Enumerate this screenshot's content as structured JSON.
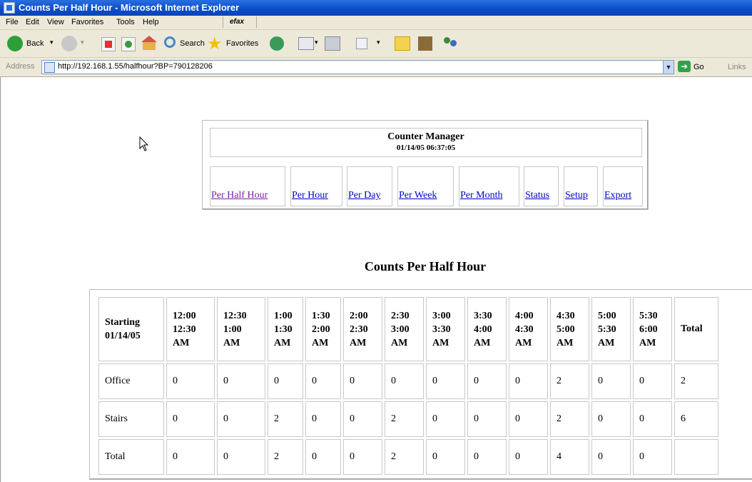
{
  "window": {
    "title": "Counts Per Half Hour - Microsoft Internet Explorer"
  },
  "menu": [
    "File",
    "Edit",
    "View",
    "Favorites",
    "Tools",
    "Help"
  ],
  "efax_label": "efax",
  "toolbar": {
    "back": "Back",
    "search": "Search",
    "favorites": "Favorites"
  },
  "address": {
    "label": "Address",
    "url": "http://192.168.1.55/halfhour?BP=790128206",
    "go": "Go",
    "links": "Links"
  },
  "manager": {
    "title": "Counter Manager",
    "datetime": "01/14/05 06:37:05",
    "nav": [
      "Per Half Hour",
      "Per Hour",
      "Per Day",
      "Per Week",
      "Per Month",
      "Status",
      "Setup",
      "Export"
    ]
  },
  "section_title": "Counts Per Half Hour",
  "table": {
    "corner": [
      "Starting",
      "01/14/05"
    ],
    "columns": [
      [
        "12:00",
        "12:30",
        "AM"
      ],
      [
        "12:30",
        "1:00",
        "AM"
      ],
      [
        "1:00",
        "1:30",
        "AM"
      ],
      [
        "1:30",
        "2:00",
        "AM"
      ],
      [
        "2:00",
        "2:30",
        "AM"
      ],
      [
        "2:30",
        "3:00",
        "AM"
      ],
      [
        "3:00",
        "3:30",
        "AM"
      ],
      [
        "3:30",
        "4:00",
        "AM"
      ],
      [
        "4:00",
        "4:30",
        "AM"
      ],
      [
        "4:30",
        "5:00",
        "AM"
      ],
      [
        "5:00",
        "5:30",
        "AM"
      ],
      [
        "5:30",
        "6:00",
        "AM"
      ]
    ],
    "total_header": "Total",
    "rows": [
      {
        "label": "Office",
        "values": [
          "0",
          "0",
          "0",
          "0",
          "0",
          "0",
          "0",
          "0",
          "0",
          "2",
          "0",
          "0"
        ],
        "total": "2"
      },
      {
        "label": "Stairs",
        "values": [
          "0",
          "0",
          "2",
          "0",
          "0",
          "2",
          "0",
          "0",
          "0",
          "2",
          "0",
          "0"
        ],
        "total": "6"
      },
      {
        "label": "Total",
        "values": [
          "0",
          "0",
          "2",
          "0",
          "0",
          "2",
          "0",
          "0",
          "0",
          "4",
          "0",
          "0"
        ],
        "total": ""
      }
    ]
  }
}
